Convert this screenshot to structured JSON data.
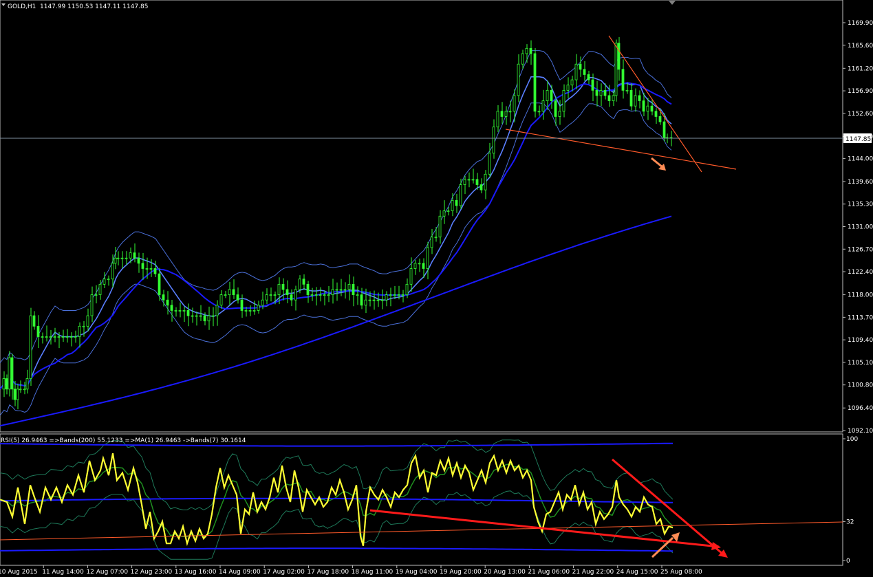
{
  "chart_data": [
    {
      "type": "candlestick",
      "title": "GOLD,H1",
      "ohlc_label": "1147.99 1150.53 1147.11 1147.85",
      "last_price": 1147.85,
      "last_price_label": "1147.85",
      "ylim": [
        1090.8,
        1172.1
      ],
      "y_ticks": [
        "1169.90",
        "1165.60",
        "1161.20",
        "1156.90",
        "1152.60",
        "1148.20",
        "1144.00",
        "1139.60",
        "1135.30",
        "1131.00",
        "1126.70",
        "1122.40",
        "1118.00",
        "1113.70",
        "1109.40",
        "1105.10",
        "1100.80",
        "1096.40",
        "1092.10"
      ],
      "x_ticks": [
        "10 Aug 2015",
        "11 Aug 14:00",
        "12 Aug 07:00",
        "12 Aug 23:00",
        "13 Aug 16:00",
        "14 Aug 09:00",
        "17 Aug 02:00",
        "17 Aug 18:00",
        "18 Aug 11:00",
        "19 Aug 04:00",
        "19 Aug 20:00",
        "20 Aug 13:00",
        "21 Aug 06:00",
        "21 Aug 22:00",
        "24 Aug 15:00",
        "25 Aug 08:00"
      ],
      "close_path": [
        [
          0,
          1100
        ],
        [
          6,
          1102
        ],
        [
          10,
          1100
        ],
        [
          14,
          1106
        ],
        [
          18,
          1100
        ],
        [
          22,
          1098
        ],
        [
          26,
          1100
        ],
        [
          30,
          1100
        ],
        [
          36,
          1100
        ],
        [
          40,
          1102
        ],
        [
          45,
          1114
        ],
        [
          50,
          1112
        ],
        [
          56,
          1110
        ],
        [
          62,
          1110
        ],
        [
          68,
          1110
        ],
        [
          74,
          1110
        ],
        [
          80,
          1110
        ],
        [
          86,
          1110
        ],
        [
          92,
          1110
        ],
        [
          98,
          1110
        ],
        [
          104,
          1110
        ],
        [
          110,
          1110
        ],
        [
          116,
          1112
        ],
        [
          122,
          1112
        ],
        [
          128,
          1114
        ],
        [
          134,
          1118
        ],
        [
          140,
          1118
        ],
        [
          146,
          1120
        ],
        [
          152,
          1121
        ],
        [
          158,
          1121
        ],
        [
          164,
          1124
        ],
        [
          168,
          1125
        ],
        [
          172,
          1125
        ],
        [
          178,
          1125
        ],
        [
          184,
          1125
        ],
        [
          190,
          1126
        ],
        [
          196,
          1125
        ],
        [
          202,
          1124
        ],
        [
          208,
          1123
        ],
        [
          214,
          1123
        ],
        [
          220,
          1123
        ],
        [
          226,
          1122
        ],
        [
          232,
          1118
        ],
        [
          238,
          1117
        ],
        [
          244,
          1116
        ],
        [
          250,
          1115
        ],
        [
          256,
          1115
        ],
        [
          262,
          1115
        ],
        [
          268,
          1115
        ],
        [
          274,
          1114
        ],
        [
          280,
          1114
        ],
        [
          286,
          1114
        ],
        [
          292,
          1114
        ],
        [
          298,
          1113
        ],
        [
          304,
          1114
        ],
        [
          310,
          1114
        ],
        [
          316,
          1116
        ],
        [
          322,
          1118
        ],
        [
          328,
          1118
        ],
        [
          334,
          1119
        ],
        [
          340,
          1118
        ],
        [
          346,
          1117
        ],
        [
          352,
          1115
        ],
        [
          358,
          1115
        ],
        [
          364,
          1115
        ],
        [
          370,
          1115
        ],
        [
          376,
          1116
        ],
        [
          382,
          1117
        ],
        [
          388,
          1118
        ],
        [
          394,
          1118
        ],
        [
          400,
          1118
        ],
        [
          406,
          1120
        ],
        [
          412,
          1119
        ],
        [
          418,
          1118
        ],
        [
          424,
          1117
        ],
        [
          430,
          1119
        ],
        [
          436,
          1121
        ],
        [
          442,
          1120
        ],
        [
          448,
          1118
        ],
        [
          454,
          1118
        ],
        [
          460,
          1118
        ],
        [
          466,
          1118
        ],
        [
          472,
          1118
        ],
        [
          478,
          1118
        ],
        [
          484,
          1119
        ],
        [
          490,
          1119
        ],
        [
          496,
          1119
        ],
        [
          502,
          1119
        ],
        [
          508,
          1120
        ],
        [
          514,
          1118
        ],
        [
          520,
          1118
        ],
        [
          526,
          1116
        ],
        [
          532,
          1117
        ],
        [
          538,
          1117
        ],
        [
          544,
          1117
        ],
        [
          550,
          1117
        ],
        [
          556,
          1117
        ],
        [
          562,
          1118
        ],
        [
          568,
          1118
        ],
        [
          574,
          1118
        ],
        [
          580,
          1118
        ],
        [
          586,
          1118
        ],
        [
          592,
          1120
        ],
        [
          598,
          1123
        ],
        [
          604,
          1124
        ],
        [
          610,
          1124
        ],
        [
          616,
          1123
        ],
        [
          622,
          1127
        ],
        [
          628,
          1129
        ],
        [
          634,
          1129
        ],
        [
          640,
          1133
        ],
        [
          646,
          1134
        ],
        [
          652,
          1134
        ],
        [
          658,
          1136
        ],
        [
          664,
          1135
        ],
        [
          670,
          1139
        ],
        [
          676,
          1140
        ],
        [
          682,
          1140
        ],
        [
          688,
          1140
        ],
        [
          694,
          1139
        ],
        [
          700,
          1138
        ],
        [
          706,
          1141
        ],
        [
          712,
          1145
        ],
        [
          718,
          1150
        ],
        [
          724,
          1153
        ],
        [
          730,
          1152
        ],
        [
          736,
          1153
        ],
        [
          742,
          1153
        ],
        [
          748,
          1156
        ],
        [
          754,
          1162
        ],
        [
          760,
          1164
        ],
        [
          766,
          1165
        ],
        [
          772,
          1164
        ],
        [
          778,
          1153
        ],
        [
          784,
          1153
        ],
        [
          790,
          1155
        ],
        [
          796,
          1157
        ],
        [
          802,
          1155
        ],
        [
          808,
          1152
        ],
        [
          814,
          1153
        ],
        [
          820,
          1157
        ],
        [
          826,
          1158
        ],
        [
          832,
          1159
        ],
        [
          838,
          1162
        ],
        [
          844,
          1161
        ],
        [
          850,
          1160
        ],
        [
          856,
          1159
        ],
        [
          862,
          1157
        ],
        [
          868,
          1156
        ],
        [
          874,
          1157
        ],
        [
          880,
          1156
        ],
        [
          886,
          1155
        ],
        [
          892,
          1156
        ],
        [
          896,
          1166
        ],
        [
          900,
          1161
        ],
        [
          906,
          1157
        ],
        [
          912,
          1157
        ],
        [
          918,
          1154
        ],
        [
          924,
          1156
        ],
        [
          930,
          1155
        ],
        [
          936,
          1153
        ],
        [
          942,
          1154
        ],
        [
          948,
          1153
        ],
        [
          954,
          1152
        ],
        [
          960,
          1151
        ],
        [
          966,
          1148
        ],
        [
          970,
          1148
        ],
        [
          976,
          1148
        ]
      ]
    },
    {
      "type": "line",
      "title": "RSI(5) 26.9463 =>Bands(200) 55.1233 =>MA(1) 26.9463 ->Bands(7) 30.1614",
      "ylim": [
        0,
        100
      ],
      "y_ticks": [
        "100",
        "32",
        "0"
      ],
      "rsi_path": [
        [
          0,
          50
        ],
        [
          10,
          48
        ],
        [
          18,
          36
        ],
        [
          26,
          60
        ],
        [
          36,
          30
        ],
        [
          44,
          62
        ],
        [
          50,
          52
        ],
        [
          58,
          40
        ],
        [
          66,
          60
        ],
        [
          74,
          50
        ],
        [
          82,
          60
        ],
        [
          90,
          48
        ],
        [
          98,
          62
        ],
        [
          106,
          54
        ],
        [
          114,
          70
        ],
        [
          122,
          56
        ],
        [
          130,
          82
        ],
        [
          138,
          66
        ],
        [
          146,
          74
        ],
        [
          150,
          84
        ],
        [
          158,
          70
        ],
        [
          164,
          88
        ],
        [
          170,
          66
        ],
        [
          178,
          72
        ],
        [
          186,
          58
        ],
        [
          194,
          76
        ],
        [
          200,
          64
        ],
        [
          206,
          46
        ],
        [
          212,
          26
        ],
        [
          218,
          40
        ],
        [
          224,
          18
        ],
        [
          230,
          24
        ],
        [
          236,
          32
        ],
        [
          242,
          14
        ],
        [
          248,
          14
        ],
        [
          254,
          24
        ],
        [
          260,
          18
        ],
        [
          266,
          28
        ],
        [
          272,
          14
        ],
        [
          278,
          24
        ],
        [
          284,
          16
        ],
        [
          290,
          26
        ],
        [
          296,
          18
        ],
        [
          302,
          22
        ],
        [
          308,
          38
        ],
        [
          314,
          60
        ],
        [
          320,
          76
        ],
        [
          326,
          60
        ],
        [
          332,
          70
        ],
        [
          338,
          62
        ],
        [
          344,
          54
        ],
        [
          350,
          22
        ],
        [
          356,
          42
        ],
        [
          362,
          38
        ],
        [
          368,
          56
        ],
        [
          374,
          40
        ],
        [
          380,
          48
        ],
        [
          386,
          42
        ],
        [
          392,
          52
        ],
        [
          398,
          68
        ],
        [
          404,
          56
        ],
        [
          410,
          78
        ],
        [
          416,
          60
        ],
        [
          422,
          48
        ],
        [
          428,
          74
        ],
        [
          434,
          60
        ],
        [
          440,
          40
        ],
        [
          446,
          58
        ],
        [
          452,
          52
        ],
        [
          458,
          46
        ],
        [
          464,
          52
        ],
        [
          470,
          44
        ],
        [
          476,
          48
        ],
        [
          482,
          60
        ],
        [
          488,
          54
        ],
        [
          494,
          66
        ],
        [
          500,
          56
        ],
        [
          506,
          42
        ],
        [
          512,
          50
        ],
        [
          518,
          62
        ],
        [
          524,
          20
        ],
        [
          528,
          12
        ],
        [
          532,
          40
        ],
        [
          538,
          60
        ],
        [
          544,
          54
        ],
        [
          550,
          50
        ],
        [
          556,
          58
        ],
        [
          562,
          52
        ],
        [
          568,
          44
        ],
        [
          574,
          56
        ],
        [
          580,
          52
        ],
        [
          586,
          58
        ],
        [
          592,
          62
        ],
        [
          598,
          80
        ],
        [
          604,
          86
        ],
        [
          610,
          68
        ],
        [
          616,
          74
        ],
        [
          622,
          56
        ],
        [
          628,
          72
        ],
        [
          634,
          70
        ],
        [
          640,
          82
        ],
        [
          646,
          74
        ],
        [
          652,
          84
        ],
        [
          658,
          70
        ],
        [
          664,
          80
        ],
        [
          670,
          68
        ],
        [
          676,
          78
        ],
        [
          682,
          72
        ],
        [
          688,
          58
        ],
        [
          694,
          66
        ],
        [
          700,
          74
        ],
        [
          706,
          64
        ],
        [
          712,
          80
        ],
        [
          718,
          86
        ],
        [
          724,
          74
        ],
        [
          730,
          82
        ],
        [
          736,
          72
        ],
        [
          742,
          82
        ],
        [
          748,
          74
        ],
        [
          754,
          78
        ],
        [
          760,
          68
        ],
        [
          766,
          74
        ],
        [
          772,
          66
        ],
        [
          776,
          44
        ],
        [
          782,
          32
        ],
        [
          788,
          24
        ],
        [
          794,
          38
        ],
        [
          800,
          40
        ],
        [
          806,
          48
        ],
        [
          812,
          56
        ],
        [
          818,
          42
        ],
        [
          824,
          54
        ],
        [
          830,
          50
        ],
        [
          836,
          62
        ],
        [
          842,
          46
        ],
        [
          848,
          56
        ],
        [
          854,
          42
        ],
        [
          860,
          48
        ],
        [
          866,
          30
        ],
        [
          872,
          40
        ],
        [
          878,
          34
        ],
        [
          884,
          38
        ],
        [
          890,
          44
        ],
        [
          896,
          66
        ],
        [
          900,
          52
        ],
        [
          906,
          46
        ],
        [
          912,
          42
        ],
        [
          918,
          36
        ],
        [
          924,
          44
        ],
        [
          930,
          40
        ],
        [
          936,
          52
        ],
        [
          942,
          46
        ],
        [
          948,
          44
        ],
        [
          954,
          30
        ],
        [
          960,
          34
        ],
        [
          966,
          22
        ],
        [
          972,
          28
        ],
        [
          978,
          27
        ]
      ]
    }
  ]
}
